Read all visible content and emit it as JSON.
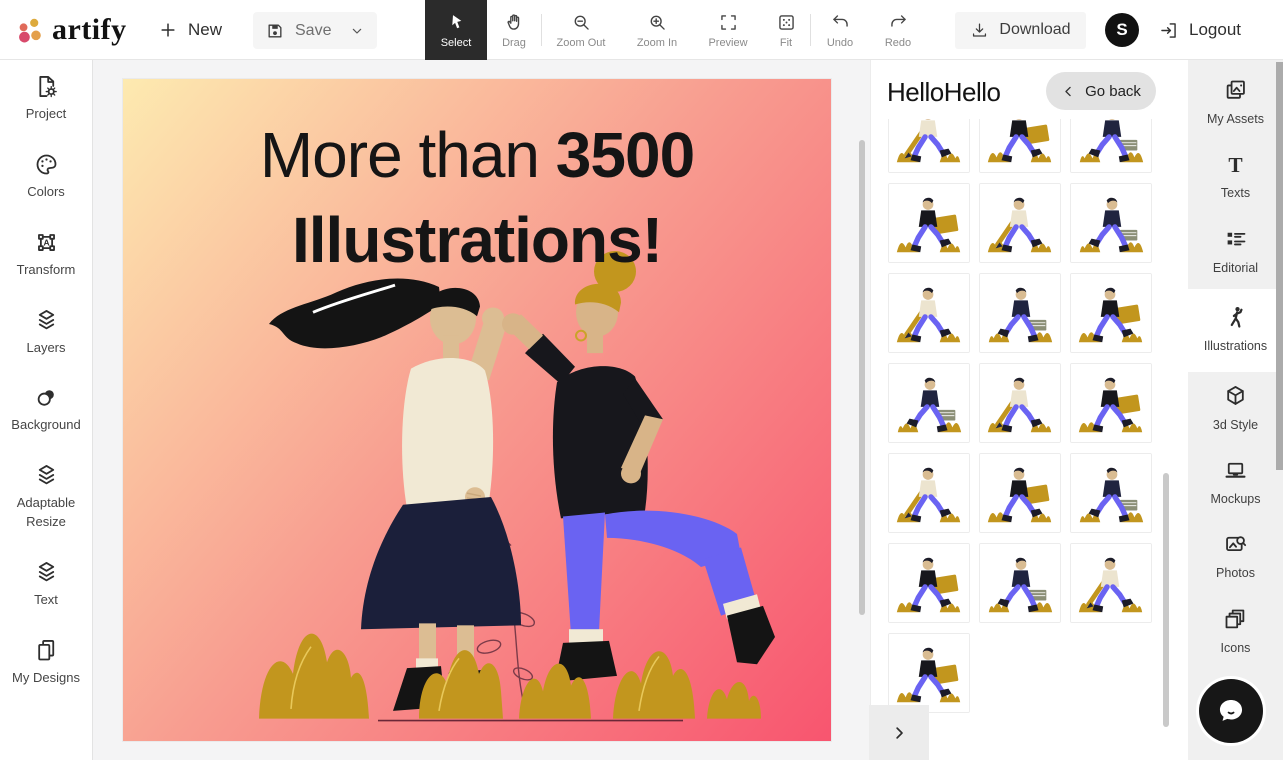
{
  "topbar": {
    "logo": {
      "text": "artify"
    },
    "new_label": "New",
    "save_label": "Save",
    "tools": [
      {
        "label": "Select",
        "icon": "cursor-icon",
        "active": true
      },
      {
        "label": "Drag",
        "icon": "hand-icon",
        "divider_after": true
      },
      {
        "label": "Zoom Out",
        "icon": "zoom-out-icon"
      },
      {
        "label": "Zoom In",
        "icon": "zoom-in-icon"
      },
      {
        "label": "Preview",
        "icon": "preview-icon"
      },
      {
        "label": "Fit",
        "icon": "fit-icon",
        "divider_after": true
      },
      {
        "label": "Undo",
        "icon": "undo-icon"
      },
      {
        "label": "Redo",
        "icon": "redo-icon"
      }
    ],
    "download_label": "Download",
    "avatar_initial": "S",
    "logout_label": "Logout"
  },
  "left_sidebar": {
    "items": [
      {
        "label": "Project",
        "icon": "project-icon"
      },
      {
        "label": "Colors",
        "icon": "colors-icon"
      },
      {
        "label": "Transform",
        "icon": "transform-icon"
      },
      {
        "label": "Layers",
        "icon": "layers-icon"
      },
      {
        "label": "Background",
        "icon": "background-icon"
      },
      {
        "label": "Adaptable Resize",
        "icon": "adaptable-resize-icon"
      },
      {
        "label": "Text",
        "icon": "text-icon"
      },
      {
        "label": "My Designs",
        "icon": "my-designs-icon"
      }
    ]
  },
  "canvas": {
    "heading_prefix": "More than ",
    "heading_highlight": "3500",
    "heading_line2": "Illustrations!"
  },
  "panel": {
    "title": "HelloHello",
    "go_back_label": "Go back",
    "thumbnail_count": 19,
    "thumbnails": [
      0,
      1,
      2,
      1,
      0,
      2,
      0,
      2,
      1,
      2,
      0,
      1,
      0,
      1,
      2,
      1,
      2,
      0,
      1
    ]
  },
  "right_sidebar": {
    "items": [
      {
        "label": "My Assets",
        "icon": "my-assets-icon"
      },
      {
        "label": "Texts",
        "icon": "texts-icon"
      },
      {
        "label": "Editorial",
        "icon": "editorial-icon"
      },
      {
        "label": "Illustrations",
        "icon": "illustrations-icon",
        "active": true
      },
      {
        "label": "3d Style",
        "icon": "3d-style-icon"
      },
      {
        "label": "Mockups",
        "icon": "mockups-icon"
      },
      {
        "label": "Photos",
        "icon": "photos-icon"
      },
      {
        "label": "Icons",
        "icon": "icons-icon"
      },
      {
        "label": "",
        "icon": "shapes-icon"
      }
    ]
  },
  "colors": {
    "poster_gradient_from": "#fdeab0",
    "poster_gradient_mid": "#f89d90",
    "poster_gradient_to": "#f8556f",
    "illustration_gold": "#c2961e",
    "illustration_navy": "#1b1f3a",
    "illustration_periwinkle": "#6a63f2",
    "illustration_skin": "#dcbd93",
    "illustration_cream": "#f1e9d4",
    "ink": "#151515",
    "logo_dot_coral": "#e06a5a",
    "logo_dot_yellow": "#ddaa3d",
    "logo_dot_crimson": "#d8496b",
    "logo_dot_orange": "#e4a04b",
    "active_tool_bg": "#2b2b2b"
  }
}
